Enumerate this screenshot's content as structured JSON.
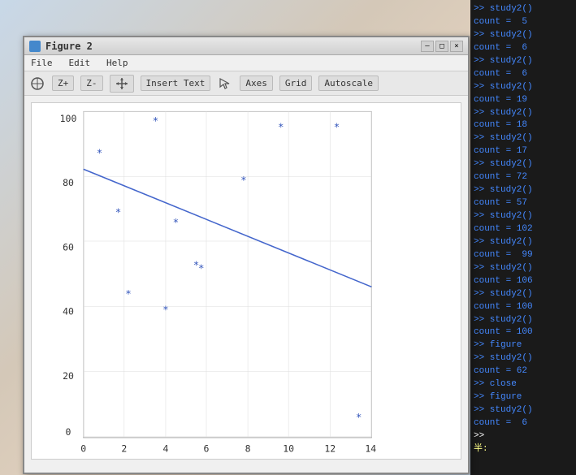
{
  "window": {
    "title": "Figure 2",
    "title_icon_color": "#4488cc"
  },
  "title_buttons": {
    "minimize": "–",
    "maximize": "□",
    "close": "×"
  },
  "menu": {
    "items": [
      "File",
      "Edit",
      "Help"
    ]
  },
  "toolbar": {
    "home_icon": "⌂",
    "zplus_label": "Z+",
    "zminus_label": "Z-",
    "pan_icon": "✛",
    "insert_text_label": "Insert Text",
    "cursor_icon": "↖",
    "axes_label": "Axes",
    "grid_label": "Grid",
    "autoscale_label": "Autoscale"
  },
  "plot": {
    "x_min": 0,
    "x_max": 14,
    "y_min": 0,
    "y_max": 100,
    "x_ticks": [
      0,
      2,
      4,
      6,
      8,
      10,
      12,
      14
    ],
    "y_ticks": [
      0,
      20,
      40,
      60,
      80,
      100
    ],
    "scatter_points": [
      {
        "x": 0.8,
        "y": 87
      },
      {
        "x": 1.7,
        "y": 69
      },
      {
        "x": 2.2,
        "y": 44
      },
      {
        "x": 3.5,
        "y": 97
      },
      {
        "x": 4.0,
        "y": 39
      },
      {
        "x": 4.5,
        "y": 66
      },
      {
        "x": 5.5,
        "y": 53
      },
      {
        "x": 5.6,
        "y": 52
      },
      {
        "x": 7.8,
        "y": 79
      },
      {
        "x": 9.6,
        "y": 95
      },
      {
        "x": 12.3,
        "y": 95
      },
      {
        "x": 13.4,
        "y": 6
      }
    ],
    "regression_line": [
      {
        "x": 0,
        "y": 82
      },
      {
        "x": 14,
        "y": 46
      }
    ]
  },
  "terminal": {
    "lines": [
      {
        "type": "prompt",
        "text": ">> study2()"
      },
      {
        "type": "result",
        "text": "count =  5"
      },
      {
        "type": "prompt",
        "text": ">> study2()"
      },
      {
        "type": "result",
        "text": "count =  6"
      },
      {
        "type": "prompt",
        "text": ">> study2()"
      },
      {
        "type": "result",
        "text": "count =  6"
      },
      {
        "type": "prompt",
        "text": ">> study2()"
      },
      {
        "type": "result",
        "text": "count = 19"
      },
      {
        "type": "prompt",
        "text": ">> study2()"
      },
      {
        "type": "result",
        "text": "count = 18"
      },
      {
        "type": "prompt",
        "text": ">> study2()"
      },
      {
        "type": "result",
        "text": "count = 17"
      },
      {
        "type": "prompt",
        "text": ">> study2()"
      },
      {
        "type": "result",
        "text": "count = 72"
      },
      {
        "type": "prompt",
        "text": ">> study2()"
      },
      {
        "type": "result",
        "text": "count = 57"
      },
      {
        "type": "prompt",
        "text": ">> study2()"
      },
      {
        "type": "result",
        "text": "count = 102"
      },
      {
        "type": "prompt",
        "text": ">> study2()"
      },
      {
        "type": "result",
        "text": "count =  99"
      },
      {
        "type": "prompt",
        "text": ">> study2()"
      },
      {
        "type": "result",
        "text": "count = 106"
      },
      {
        "type": "prompt",
        "text": ">> study2()"
      },
      {
        "type": "result",
        "text": "count = 100"
      },
      {
        "type": "prompt",
        "text": ">> study2()"
      },
      {
        "type": "result",
        "text": "count = 100"
      },
      {
        "type": "prompt",
        "text": ">> figure"
      },
      {
        "type": "prompt",
        "text": ">> study2()"
      },
      {
        "type": "result",
        "text": "count = 62"
      },
      {
        "type": "prompt",
        "text": ">> close"
      },
      {
        "type": "prompt",
        "text": ">> figure"
      },
      {
        "type": "prompt",
        "text": ">> study2()"
      },
      {
        "type": "result",
        "text": "count =  6"
      },
      {
        "type": "cursor",
        "text": ">> "
      }
    ],
    "cursor_char": "半:"
  }
}
